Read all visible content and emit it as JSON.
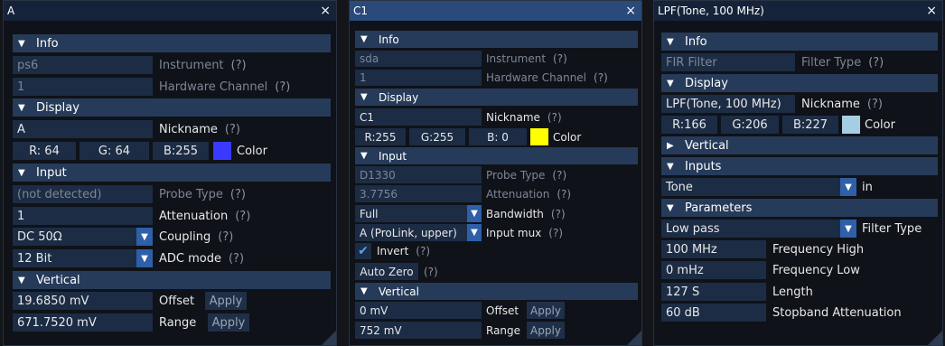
{
  "colors": {
    "titlebar_active": "#294a7a",
    "titlebar_inactive": "#15233a",
    "section": "#263b59",
    "field": "#1c2c44",
    "accent": "#2e5fa8"
  },
  "icons": {
    "close": "close-icon",
    "expanded": "triangle-down-icon",
    "collapsed": "triangle-right-icon",
    "dropdown": "dropdown-arrow-icon",
    "check": "checkmark-icon"
  },
  "p1": {
    "title": "A",
    "close": "×",
    "info": {
      "header": "Info",
      "instrument": "ps6",
      "instrument_label": "Instrument",
      "channel": "1",
      "channel_label": "Hardware Channel",
      "help": "(?)"
    },
    "display": {
      "header": "Display",
      "nickname": "A",
      "nickname_label": "Nickname",
      "r": "R: 64",
      "g": "G: 64",
      "b": "B:255",
      "color_label": "Color",
      "swatch": "#3a3aff"
    },
    "input": {
      "header": "Input",
      "probe": "(not detected)",
      "probe_label": "Probe Type",
      "atten": "1",
      "atten_label": "Attenuation",
      "coupling": "DC 50Ω",
      "coupling_label": "Coupling",
      "adc": "12 Bit",
      "adc_label": "ADC mode"
    },
    "vertical": {
      "header": "Vertical",
      "offset": "19.6850 mV",
      "offset_label": "Offset",
      "range": "671.7520 mV",
      "range_label": "Range",
      "apply": "Apply"
    }
  },
  "p2": {
    "title": "C1",
    "close": "×",
    "info": {
      "header": "Info",
      "instrument": "sda",
      "instrument_label": "Instrument",
      "channel": "1",
      "channel_label": "Hardware Channel",
      "help": "(?)"
    },
    "display": {
      "header": "Display",
      "nickname": "C1",
      "nickname_label": "Nickname",
      "r": "R:255",
      "g": "G:255",
      "b": "B:  0",
      "color_label": "Color",
      "swatch": "#ffff00"
    },
    "input": {
      "header": "Input",
      "probe": "D1330",
      "probe_label": "Probe Type",
      "atten": "3.7756",
      "atten_label": "Attenuation",
      "bandwidth": "Full",
      "bandwidth_label": "Bandwidth",
      "mux": "A (ProLink, upper)",
      "mux_label": "Input mux",
      "invert_label": "Invert",
      "autozero": "Auto Zero"
    },
    "vertical": {
      "header": "Vertical",
      "offset": "0 mV",
      "offset_label": "Offset",
      "range": "752 mV",
      "range_label": "Range",
      "apply": "Apply"
    }
  },
  "p3": {
    "title": "LPF(Tone, 100 MHz)",
    "close": "×",
    "info": {
      "header": "Info",
      "filter": "FIR Filter",
      "filter_label": "Filter Type",
      "help": "(?)"
    },
    "display": {
      "header": "Display",
      "nickname": "LPF(Tone, 100 MHz)",
      "nickname_label": "Nickname",
      "r": "R:166",
      "g": "G:206",
      "b": "B:227",
      "color_label": "Color",
      "swatch": "#a6cee3"
    },
    "vertical": {
      "header": "Vertical"
    },
    "inputs": {
      "header": "Inputs",
      "in": "Tone",
      "in_label": "in"
    },
    "params": {
      "header": "Parameters",
      "type": "Low pass",
      "type_label": "Filter Type",
      "fhigh": "100 MHz",
      "fhigh_label": "Frequency High",
      "flow": "0 mHz",
      "flow_label": "Frequency Low",
      "length": "127 S",
      "length_label": "Length",
      "atten": "60 dB",
      "atten_label": "Stopband Attenuation"
    }
  }
}
